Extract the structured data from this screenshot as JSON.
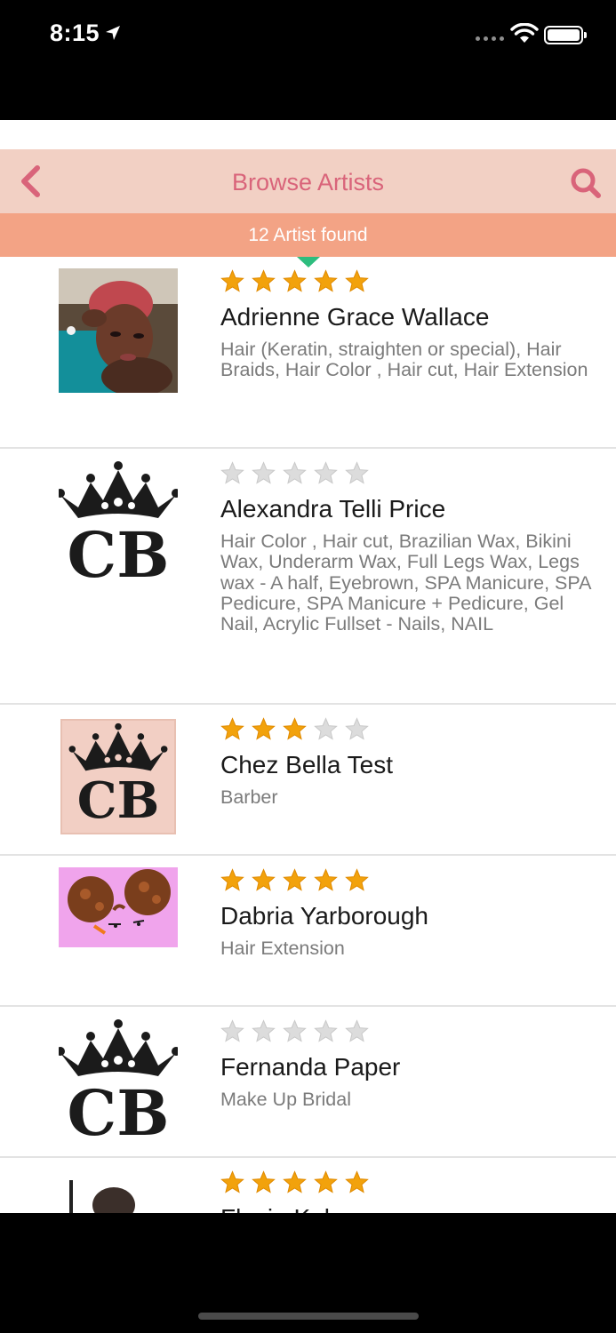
{
  "status_bar": {
    "time": "8:15"
  },
  "nav": {
    "title": "Browse Artists",
    "back_icon": "chevron-left-icon",
    "search_icon": "search-icon",
    "accent": "#d9647a",
    "bar_color": "#f2d0c4"
  },
  "results": {
    "text": "12 Artist found",
    "bar_color": "#f3a385"
  },
  "artists": [
    {
      "name": "Adrienne Grace Wallace",
      "rating": 5,
      "avatar": "photo",
      "services": "Hair (Keratin, straighten or special), Hair Braids, Hair Color , Hair cut, Hair Extension"
    },
    {
      "name": "Alexandra Telli Price",
      "rating": 0,
      "avatar": "cb-logo",
      "services": "Hair Color , Hair cut, Brazilian Wax, Bikini Wax, Underarm Wax, Full Legs Wax, Legs wax - A half, Eyebrown, SPA Manicure, SPA Pedicure, SPA Manicure + Pedicure, Gel Nail, Acrylic Fullset - Nails, NAIL"
    },
    {
      "name": "Chez Bella Test",
      "rating": 3,
      "avatar": "cb-logo-pink",
      "services": "Barber"
    },
    {
      "name": "Dabria Yarborough",
      "rating": 5,
      "avatar": "illustration",
      "services": "Hair Extension"
    },
    {
      "name": "Fernanda Paper",
      "rating": 0,
      "avatar": "cb-logo",
      "services": "Make Up Bridal"
    },
    {
      "name": "Flavia Kalman",
      "rating": 5,
      "avatar": "photo",
      "services": ""
    }
  ],
  "colors": {
    "star_filled": "#f2a20c",
    "star_empty": "#dcdcdc"
  }
}
